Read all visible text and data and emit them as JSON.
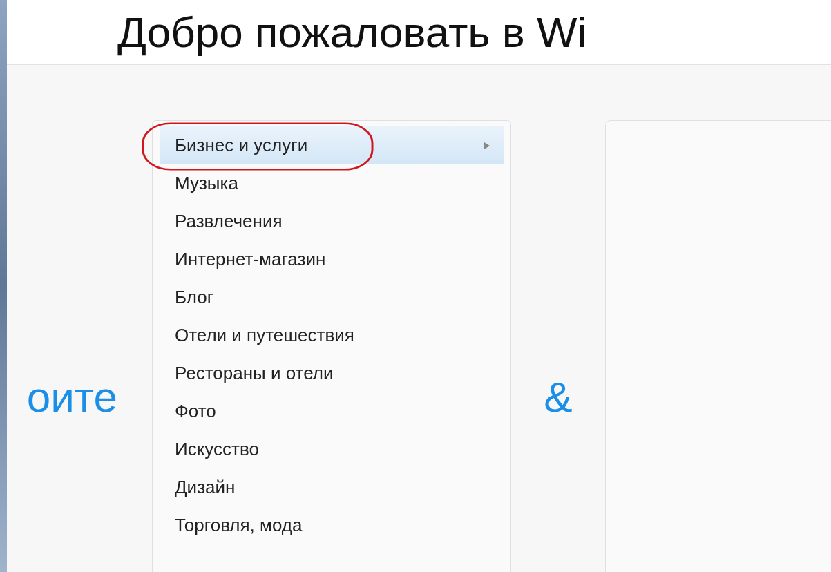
{
  "header": {
    "title": "Добро пожаловать в Wi"
  },
  "left_fragment": "оите",
  "ampersand": "&",
  "menu": {
    "items": [
      {
        "label": "Бизнес и услуги",
        "selected": true,
        "submenu": true,
        "annotated": true
      },
      {
        "label": "Музыка",
        "selected": false,
        "submenu": false,
        "annotated": false
      },
      {
        "label": "Развлечения",
        "selected": false,
        "submenu": false,
        "annotated": false
      },
      {
        "label": "Интернет-магазин",
        "selected": false,
        "submenu": false,
        "annotated": false
      },
      {
        "label": "Блог",
        "selected": false,
        "submenu": false,
        "annotated": false
      },
      {
        "label": "Отели и путешествия",
        "selected": false,
        "submenu": false,
        "annotated": false
      },
      {
        "label": "Рестораны и отели",
        "selected": false,
        "submenu": false,
        "annotated": false
      },
      {
        "label": "Фото",
        "selected": false,
        "submenu": false,
        "annotated": false
      },
      {
        "label": "Искусство",
        "selected": false,
        "submenu": false,
        "annotated": false
      },
      {
        "label": "Дизайн",
        "selected": false,
        "submenu": false,
        "annotated": false
      },
      {
        "label": "Торговля, мода",
        "selected": false,
        "submenu": false,
        "annotated": false
      }
    ]
  }
}
